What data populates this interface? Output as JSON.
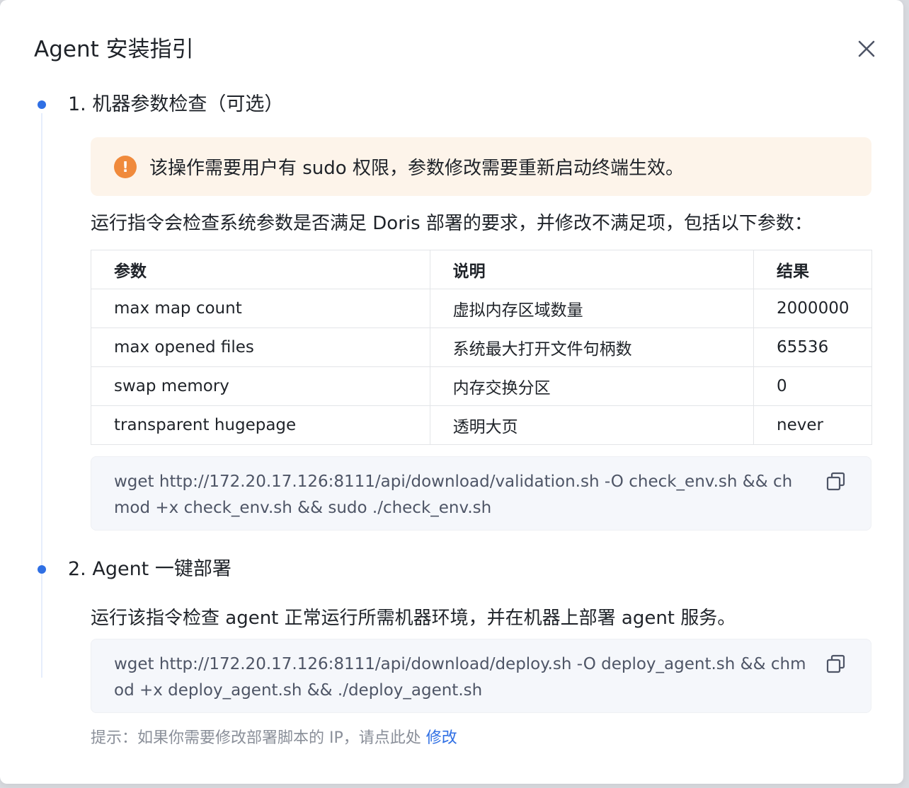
{
  "modal": {
    "title": "Agent 安装指引"
  },
  "step1": {
    "title": "1. 机器参数检查（可选）",
    "alert_text": "该操作需要用户有 sudo 权限，参数修改需要重新启动终端生效。",
    "description": "运行指令会检查系统参数是否满足 Doris 部署的要求，并修改不满足项，包括以下参数：",
    "table": {
      "headers": [
        "参数",
        "说明",
        "结果"
      ],
      "rows": [
        [
          "max map count",
          "虚拟内存区域数量",
          "2000000"
        ],
        [
          "max opened files",
          "系统最大打开文件句柄数",
          "65536"
        ],
        [
          "swap memory",
          "内存交换分区",
          "0"
        ],
        [
          "transparent hugepage",
          "透明大页",
          "never"
        ]
      ]
    },
    "command": "wget http://172.20.17.126:8111/api/download/validation.sh -O check_env.sh && chmod +x check_env.sh && sudo ./check_env.sh"
  },
  "step2": {
    "title": "2. Agent 一键部署",
    "description": "运行该指令检查 agent 正常运行所需机器环境，并在机器上部署 agent 服务。",
    "command": "wget http://172.20.17.126:8111/api/download/deploy.sh -O deploy_agent.sh && chmod +x deploy_agent.sh && ./deploy_agent.sh"
  },
  "hint": {
    "text": "提示：如果你需要修改部署脚本的 IP，请点此处 ",
    "link_label": "修改"
  },
  "icons": {
    "close": "close-icon",
    "alert": "exclamation-circle-icon",
    "copy": "copy-icon"
  },
  "colors": {
    "accent": "#2f6fe4",
    "alert_bg": "#fdf4ea",
    "alert_icon": "#f08a3c",
    "code_bg": "#f5f7fb"
  }
}
